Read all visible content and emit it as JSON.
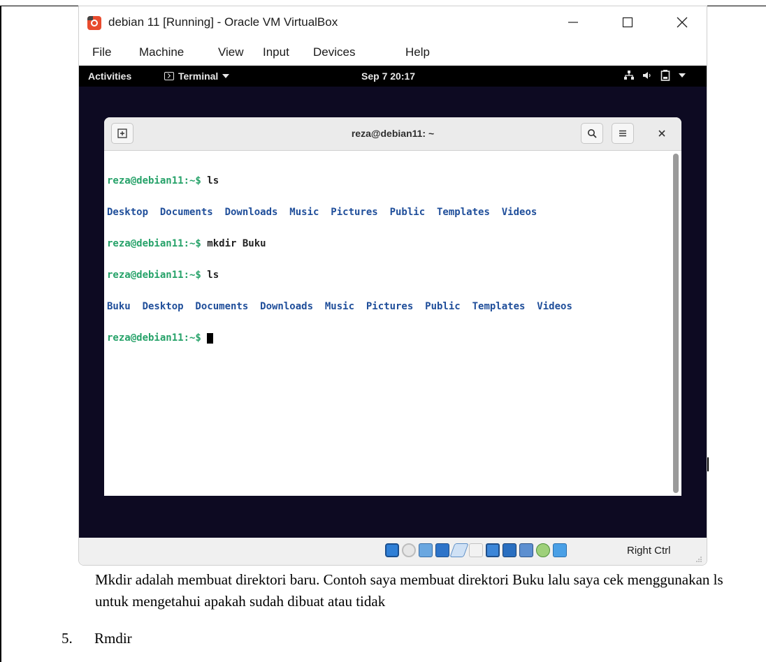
{
  "window": {
    "title": "debian 11 [Running] - Oracle VM VirtualBox",
    "menu": [
      "File",
      "Machine",
      "View",
      "Input",
      "Devices",
      "Help"
    ]
  },
  "guest": {
    "topbar": {
      "activities": "Activities",
      "app_menu": "Terminal",
      "clock": "Sep 7  20:17"
    },
    "terminal": {
      "title": "reza@debian11: ~",
      "lines": [
        {
          "prompt": "reza@debian11:~$ ",
          "command": "ls"
        },
        {
          "output": "Desktop  Documents  Downloads  Music  Pictures  Public  Templates  Videos"
        },
        {
          "prompt": "reza@debian11:~$ ",
          "command": "mkdir Buku"
        },
        {
          "prompt": "reza@debian11:~$ ",
          "command": "ls"
        },
        {
          "output": "Buku  Desktop  Documents  Downloads  Music  Pictures  Public  Templates  Videos"
        },
        {
          "prompt": "reza@debian11:~$ ",
          "command": ""
        }
      ]
    }
  },
  "statusbar": {
    "host_key": "Right Ctrl"
  },
  "document": {
    "caption": "Mkdir adalah membuat direktori baru. Contoh saya membuat direktori Buku lalu saya cek menggunakan ls untuk mengetahui apakah sudah dibuat atau tidak",
    "list_number": "5.",
    "list_text": "Rmdir"
  },
  "colors": {
    "prompt": "#26a269",
    "directory": "#1f4e9a",
    "guest_background": "#0d0a22",
    "gnome_topbar": "#000000"
  }
}
